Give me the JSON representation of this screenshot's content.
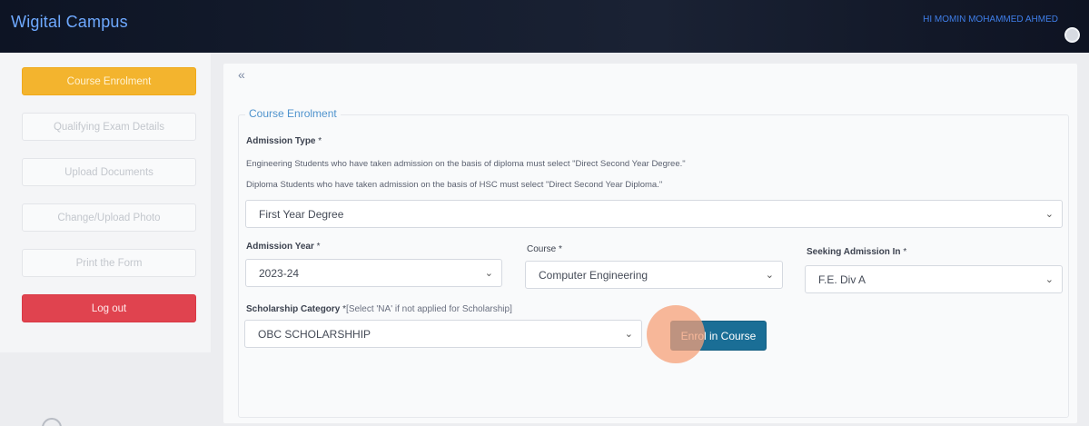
{
  "header": {
    "brand": "Wigital Campus",
    "user": "Hi MOMIN MOHAMMED AHMED"
  },
  "sidebar": {
    "items": [
      {
        "label": "Course Enrolment"
      },
      {
        "label": "Qualifying Exam Details"
      },
      {
        "label": "Upload Documents"
      },
      {
        "label": "Change/Upload Photo"
      },
      {
        "label": "Print the Form"
      },
      {
        "label": "Log out"
      }
    ]
  },
  "main": {
    "collapse_icon": "«",
    "section_title": "Course Enrolment",
    "admission_type": {
      "label": "Admission Type",
      "required": "*",
      "help1": "Engineering Students who have taken admission on the basis of diploma must select \"Direct Second Year Degree.\"",
      "help2": "Diploma Students who have taken admission on the basis of HSC must select \"Direct Second Year Diploma.\"",
      "value": "First Year Degree"
    },
    "admission_year": {
      "label": "Admission Year",
      "required": "*",
      "value": "2023-24"
    },
    "course": {
      "label": "Course",
      "required": "*",
      "value": "Computer Engineering"
    },
    "seeking_admission": {
      "label": "Seeking Admission In",
      "required": "*",
      "value": "F.E. Div A"
    },
    "scholarship": {
      "label": "Scholarship Category",
      "required": "*",
      "note": "[Select 'NA' if not applied for Scholarship]",
      "value": "OBC SCHOLARSHHIP"
    },
    "enrol_button": "Enrol in Course"
  },
  "icons": {
    "chevron": "chevron-down-icon",
    "collapse": "double-chevron-left-icon",
    "avatar": "user-avatar-icon"
  },
  "colors": {
    "header_bg": "#141b2b",
    "brand_text": "#6ea9ff",
    "active_item": "#f3b42e",
    "logout": "#e0434f",
    "enrol_button": "#1a6e96",
    "section_title": "#4f93cd"
  }
}
